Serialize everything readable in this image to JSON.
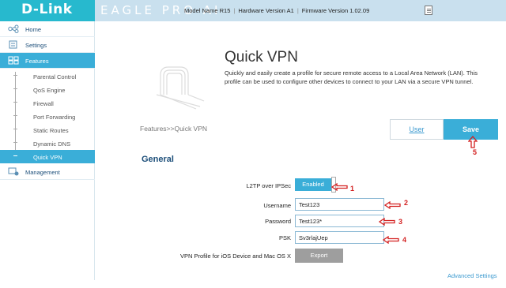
{
  "header": {
    "logo": "D-Link",
    "brand": "EAGLE PRO AI",
    "model_label": "Model Name",
    "model": "R15",
    "hw_label": "Hardware Version",
    "hw": "A1",
    "fw_label": "Firmware Version",
    "fw": "1.02.09"
  },
  "sidebar": {
    "items": [
      {
        "label": "Home",
        "icon": "home-network-icon"
      },
      {
        "label": "Settings",
        "icon": "settings-icon"
      },
      {
        "label": "Features",
        "icon": "features-icon",
        "active": true
      },
      {
        "label": "Management",
        "icon": "management-icon"
      }
    ],
    "sub_items": [
      {
        "label": "Parental Control"
      },
      {
        "label": "QoS Engine"
      },
      {
        "label": "Firewall"
      },
      {
        "label": "Port Forwarding"
      },
      {
        "label": "Static Routes"
      },
      {
        "label": "Dynamic DNS"
      },
      {
        "label": "Quick VPN",
        "active": true
      }
    ]
  },
  "main": {
    "title": "Quick VPN",
    "description": "Quickly and easily create a profile for secure remote access to a Local Area Network (LAN). This profile can be used to configure other devices to connect to your LAN via a secure VPN tunnel.",
    "breadcrumb": "Features>>Quick VPN",
    "user_button": "User",
    "save_button": "Save",
    "section": "General",
    "l2tp_label": "L2TP over IPSec",
    "l2tp_value": "Enabled",
    "username_label": "Username",
    "username_value": "Test123",
    "password_label": "Password",
    "password_value": "Test123*",
    "psk_label": "PSK",
    "psk_value": "Sv3rlajUep",
    "profile_label": "VPN Profile for iOS Device and Mac OS X",
    "export_button": "Export",
    "advanced_link": "Advanced Settings"
  },
  "annotations": {
    "numbers": [
      "1",
      "2",
      "3",
      "4",
      "5"
    ],
    "color": "#d32020"
  },
  "colors": {
    "accent": "#3aaed8",
    "logo_bg": "#27b9ce",
    "header_bg": "#c9e0ee",
    "heading": "#1d4f7a"
  }
}
